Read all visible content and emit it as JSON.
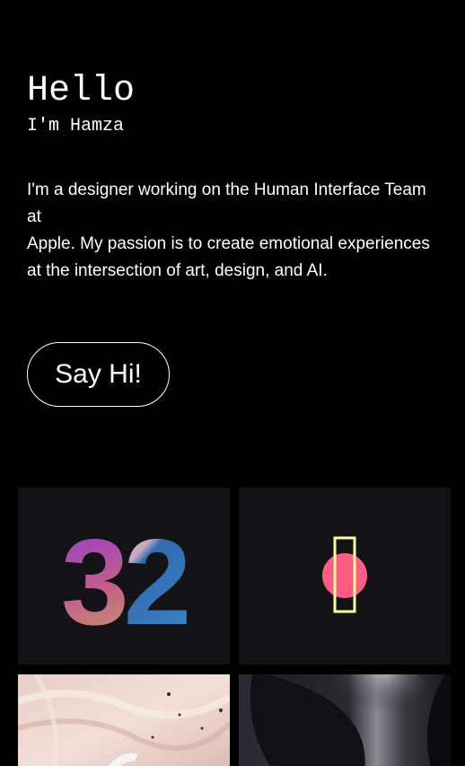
{
  "intro": {
    "greeting": "Hello",
    "name_line": "I'm Hamza"
  },
  "bio": {
    "lines": [
      "I'm a designer working on the Human Interface Team at",
      "Apple. My passion is to create emotional experiences at the intersection of art, design, and AI."
    ]
  },
  "cta": {
    "label": "Say Hi!"
  },
  "gallery": {
    "tile1_number": "32"
  },
  "colors": {
    "background": "#000000",
    "tile_bg": "#131317",
    "accent_pink": "#ff5c84",
    "accent_yellow": "#ffff99"
  }
}
